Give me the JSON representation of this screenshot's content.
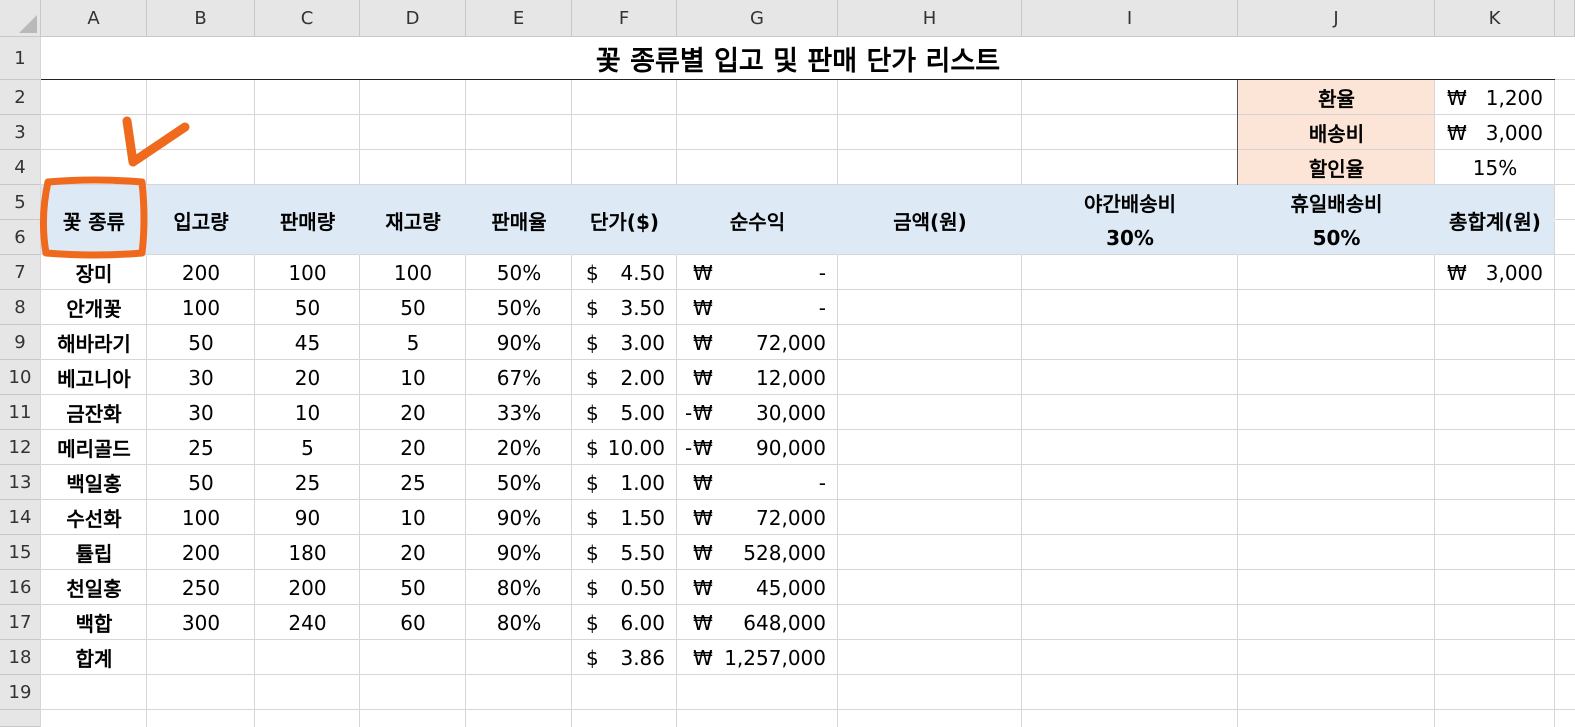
{
  "columns": [
    "A",
    "B",
    "C",
    "D",
    "E",
    "F",
    "G",
    "H",
    "I",
    "J",
    "K"
  ],
  "rows": [
    "1",
    "2",
    "3",
    "4",
    "5",
    "6",
    "7",
    "8",
    "9",
    "10",
    "11",
    "12",
    "13",
    "14",
    "15",
    "16",
    "17",
    "18",
    "19"
  ],
  "title": "꽃 종류별 입고 및 판매 단가 리스트",
  "settings": [
    {
      "label": "환율",
      "symbol": "₩",
      "value": "1,200"
    },
    {
      "label": "배송비",
      "symbol": "₩",
      "value": "3,000"
    },
    {
      "label": "할인율",
      "value": "15%"
    }
  ],
  "headers": {
    "flower": "꽃 종류",
    "in": "입고량",
    "sold": "판매량",
    "stock": "재고량",
    "rate": "판매율",
    "price": "단가($)",
    "profit": "순수익",
    "amount": "금액(원)",
    "night": "야간배송비",
    "night_pct": "30%",
    "holiday": "휴일배송비",
    "holiday_pct": "50%",
    "total": "총합계(원)"
  },
  "data_rows": [
    {
      "name": "장미",
      "in": "200",
      "sold": "100",
      "stock": "100",
      "rate": "50%",
      "price": "4.50",
      "sign": "",
      "profit": "-",
      "total": "3,000"
    },
    {
      "name": "안개꽃",
      "in": "100",
      "sold": "50",
      "stock": "50",
      "rate": "50%",
      "price": "3.50",
      "sign": "",
      "profit": "-"
    },
    {
      "name": "해바라기",
      "in": "50",
      "sold": "45",
      "stock": "5",
      "rate": "90%",
      "price": "3.00",
      "sign": "",
      "profit": "72,000"
    },
    {
      "name": "베고니아",
      "in": "30",
      "sold": "20",
      "stock": "10",
      "rate": "67%",
      "price": "2.00",
      "sign": "",
      "profit": "12,000"
    },
    {
      "name": "금잔화",
      "in": "30",
      "sold": "10",
      "stock": "20",
      "rate": "33%",
      "price": "5.00",
      "sign": "-",
      "profit": "30,000"
    },
    {
      "name": "메리골드",
      "in": "25",
      "sold": "5",
      "stock": "20",
      "rate": "20%",
      "price": "10.00",
      "sign": "-",
      "profit": "90,000"
    },
    {
      "name": "백일홍",
      "in": "50",
      "sold": "25",
      "stock": "25",
      "rate": "50%",
      "price": "1.00",
      "sign": "",
      "profit": "-"
    },
    {
      "name": "수선화",
      "in": "100",
      "sold": "90",
      "stock": "10",
      "rate": "90%",
      "price": "1.50",
      "sign": "",
      "profit": "72,000"
    },
    {
      "name": "튤립",
      "in": "200",
      "sold": "180",
      "stock": "20",
      "rate": "90%",
      "price": "5.50",
      "sign": "",
      "profit": "528,000"
    },
    {
      "name": "천일홍",
      "in": "250",
      "sold": "200",
      "stock": "50",
      "rate": "80%",
      "price": "0.50",
      "sign": "",
      "profit": "45,000"
    },
    {
      "name": "백합",
      "in": "300",
      "sold": "240",
      "stock": "60",
      "rate": "80%",
      "price": "6.00",
      "sign": "",
      "profit": "648,000"
    }
  ],
  "summary": {
    "label": "합계",
    "price": "3.86",
    "profit": "1,257,000"
  },
  "symbols": {
    "usd": "$",
    "krw": "₩"
  },
  "colors": {
    "header_fill": "#dde9f5",
    "setting_fill": "#fce4d6",
    "mark": "#f06a1d",
    "grid": "#d6d6d6",
    "headings": "#e6e6e6"
  },
  "icons": {
    "annotation": "checkmark-icon",
    "highlight": "circle-highlight"
  }
}
